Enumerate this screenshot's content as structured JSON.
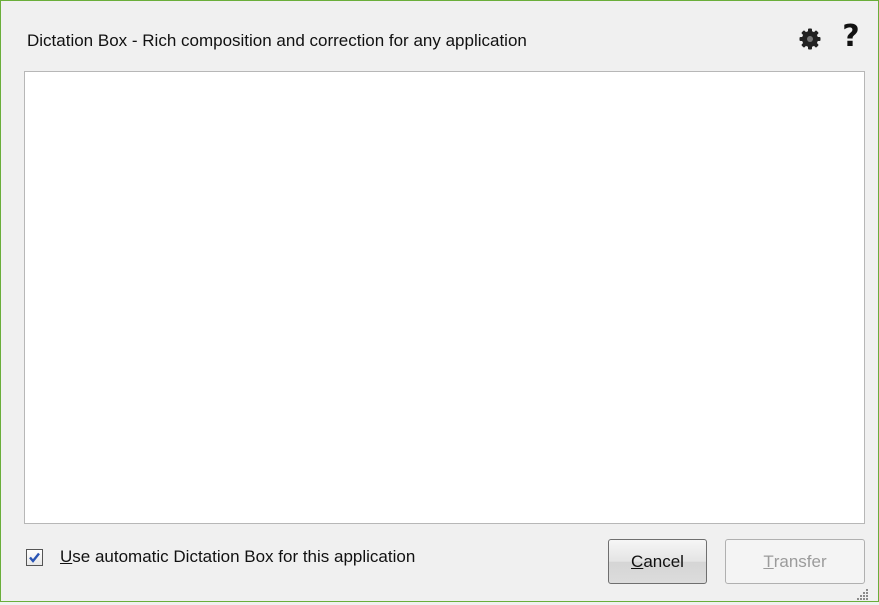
{
  "dialog": {
    "title": "Dictation Box - Rich composition and correction for any application",
    "icons": {
      "settings": "gear-icon",
      "help": "help-icon"
    },
    "help_glyph": "?"
  },
  "editor": {
    "value": ""
  },
  "auto_option": {
    "checked": true,
    "mnemonic": "U",
    "label_rest": "se automatic Dictation Box for this application"
  },
  "buttons": {
    "cancel": {
      "mnemonic": "C",
      "rest": "ancel",
      "enabled": true
    },
    "transfer": {
      "mnemonic": "T",
      "rest": "ransfer",
      "enabled": false
    }
  },
  "colors": {
    "border": "#6aae3a",
    "check": "#2a55b5"
  }
}
